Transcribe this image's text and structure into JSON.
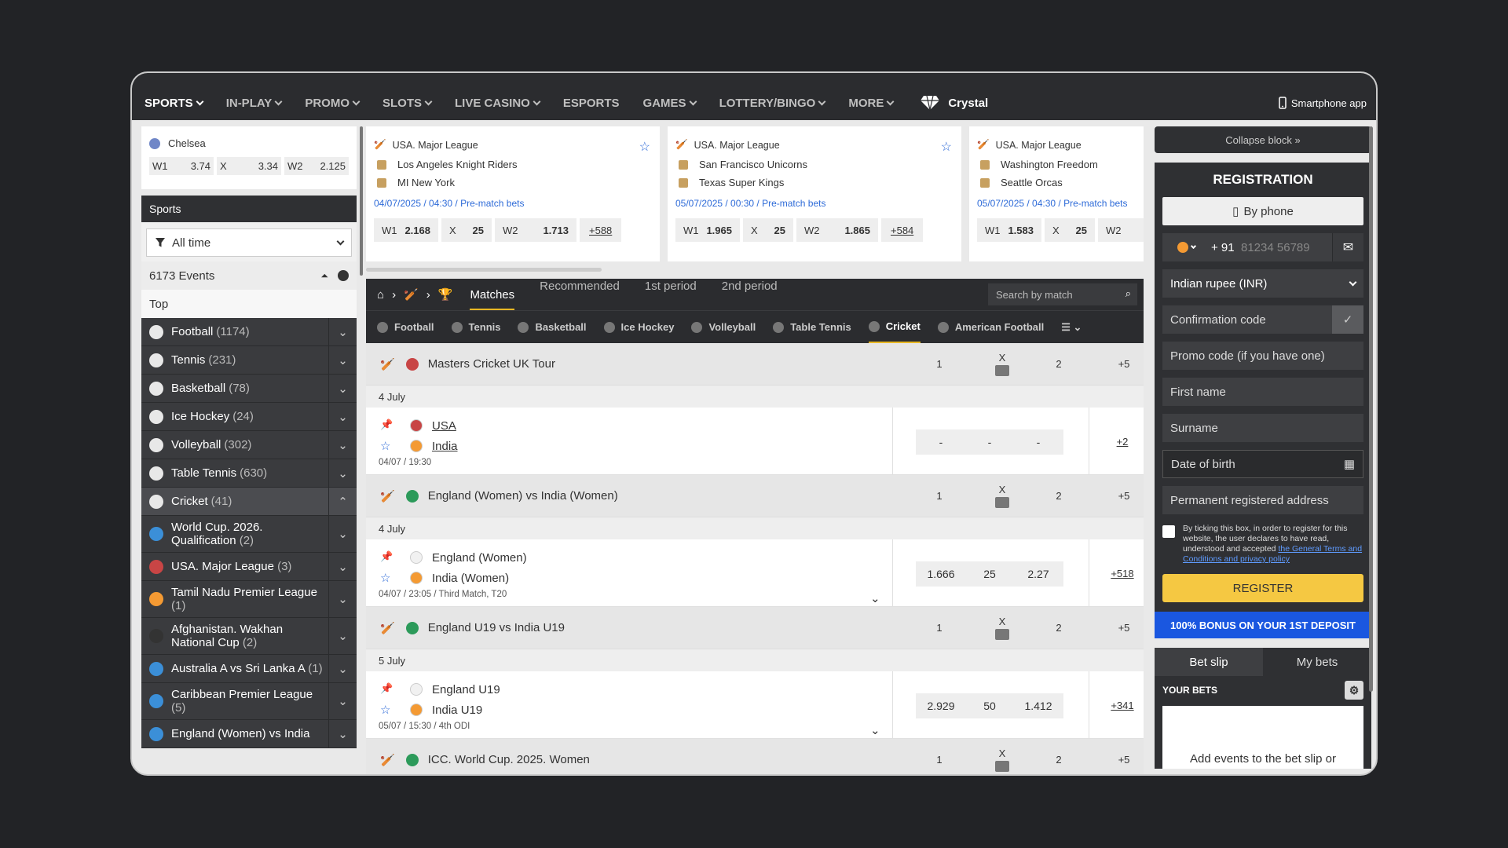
{
  "nav": {
    "items": [
      {
        "label": "SPORTS",
        "chev": true
      },
      {
        "label": "IN-PLAY",
        "chev": true
      },
      {
        "label": "PROMO",
        "chev": true
      },
      {
        "label": "SLOTS",
        "chev": true
      },
      {
        "label": "LIVE CASINO",
        "chev": true
      },
      {
        "label": "ESPORTS",
        "chev": false
      },
      {
        "label": "GAMES",
        "chev": true
      },
      {
        "label": "LOTTERY/BINGO",
        "chev": true
      },
      {
        "label": "MORE",
        "chev": true
      }
    ],
    "crystal": "Crystal",
    "smartphone": "Smartphone app"
  },
  "left": {
    "prev_team": "Chelsea",
    "prev_odds": [
      {
        "k": "W1",
        "v": "3.74"
      },
      {
        "k": "X",
        "v": "3.34"
      },
      {
        "k": "W2",
        "v": "2.125"
      }
    ],
    "sports_title": "Sports",
    "filter": "All time",
    "events": "6173 Events",
    "top": "Top",
    "sports": [
      {
        "name": "Football",
        "count": "(1174)"
      },
      {
        "name": "Tennis",
        "count": "(231)"
      },
      {
        "name": "Basketball",
        "count": "(78)"
      },
      {
        "name": "Ice Hockey",
        "count": "(24)"
      },
      {
        "name": "Volleyball",
        "count": "(302)"
      },
      {
        "name": "Table Tennis",
        "count": "(630)"
      },
      {
        "name": "Cricket",
        "count": "(41)"
      }
    ],
    "leagues": [
      {
        "name": "World Cup. 2026. Qualification",
        "count": "(2)"
      },
      {
        "name": "USA. Major League",
        "count": "(3)"
      },
      {
        "name": "Tamil Nadu Premier League",
        "count": "(1)"
      },
      {
        "name": "Afghanistan. Wakhan National Cup",
        "count": "(2)"
      },
      {
        "name": "Australia A vs Sri Lanka A",
        "count": "(1)"
      },
      {
        "name": "Caribbean Premier League",
        "count": "(5)"
      },
      {
        "name": "England (Women) vs India",
        "count": ""
      }
    ]
  },
  "cards": [
    {
      "league": "USA. Major League",
      "t1": "Los Angeles Knight Riders",
      "t2": "MI New York",
      "dt": "04/07/2025 / 04:30 / Pre-match bets",
      "w1": "2.168",
      "x": "25",
      "w2": "1.713",
      "more": "+588"
    },
    {
      "league": "USA. Major League",
      "t1": "San Francisco Unicorns",
      "t2": "Texas Super Kings",
      "dt": "05/07/2025 / 00:30 / Pre-match bets",
      "w1": "1.965",
      "x": "25",
      "w2": "1.865",
      "more": "+584"
    },
    {
      "league": "USA. Major League",
      "t1": "Washington Freedom",
      "t2": "Seattle Orcas",
      "dt": "05/07/2025 / 04:30 / Pre-match bets",
      "w1": "1.583",
      "x": "25",
      "w2": "",
      "more": ""
    }
  ],
  "odds_labels": {
    "w1": "W1",
    "x": "X",
    "w2": "W2"
  },
  "main": {
    "tabs": [
      "Matches",
      "Recommended",
      "1st period",
      "2nd period"
    ],
    "search_placeholder": "Search by match",
    "sports_tabs": [
      "Football",
      "Tennis",
      "Basketball",
      "Ice Hockey",
      "Volleyball",
      "Table Tennis",
      "Cricket",
      "American Football"
    ],
    "col_1": "1",
    "col_x": "X",
    "col_2": "2",
    "events": [
      {
        "title": "Masters Cricket UK Tour",
        "more": "+5",
        "date": "4 July",
        "t1": "USA",
        "t2": "India",
        "time": "04/07 / 19:30",
        "o1": "-",
        "ox": "-",
        "o2": "-",
        "mmore": "+2",
        "underline": true
      },
      {
        "title": "England (Women) vs India (Women)",
        "more": "+5",
        "date": "4 July",
        "t1": "England (Women)",
        "t2": "India (Women)",
        "time": "04/07 / 23:05 / Third Match, T20",
        "o1": "1.666",
        "ox": "25",
        "o2": "2.27",
        "mmore": "+518",
        "underline": false
      },
      {
        "title": "England U19 vs India U19",
        "more": "+5",
        "date": "5 July",
        "t1": "England U19",
        "t2": "India U19",
        "time": "05/07 / 15:30 / 4th ODI",
        "o1": "2.929",
        "ox": "50",
        "o2": "1.412",
        "mmore": "+341",
        "underline": false
      },
      {
        "title": "ICC. World Cup. 2025. Women",
        "more": "+5",
        "date": "",
        "t1": "",
        "t2": "",
        "time": "",
        "o1": "",
        "ox": "",
        "o2": "",
        "mmore": "",
        "underline": false
      }
    ]
  },
  "right": {
    "collapse": "Collapse block »",
    "reg_title": "REGISTRATION",
    "by_phone": "By phone",
    "code": "+ 91",
    "phone_placeholder": "81234 56789",
    "currency": "Indian rupee (INR)",
    "confirmation": "Confirmation code",
    "promo": "Promo code (if you have one)",
    "first": "First name",
    "surname": "Surname",
    "dob": "Date of birth",
    "address": "Permanent registered address",
    "terms_text": "By ticking this box, in order to register for this website, the user declares to have read, understood and accepted ",
    "terms_link": "the General Terms and Conditions and privacy policy",
    "register": "REGISTER",
    "bonus": "100% BONUS ON YOUR 1ST DEPOSIT",
    "bet_slip": "Bet slip",
    "my_bets": "My bets",
    "your_bets": "YOUR BETS",
    "empty": "Add events to the bet slip or"
  }
}
